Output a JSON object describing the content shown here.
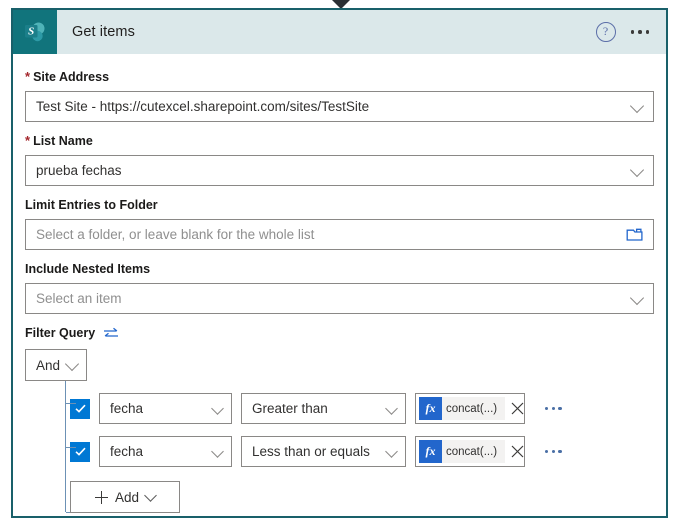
{
  "card": {
    "icon_name": "sharepoint-icon",
    "title": "Get items",
    "header_icons": {
      "help": "help-icon",
      "more": "more-options-icon"
    }
  },
  "fields": [
    {
      "label": "Site Address",
      "required": true,
      "value": "Test Site - https://cutexcel.sharepoint.com/sites/TestSite",
      "is_placeholder": false,
      "trailing_icon": "chevron-down-icon"
    },
    {
      "label": "List Name",
      "required": true,
      "value": "prueba fechas",
      "is_placeholder": false,
      "trailing_icon": "chevron-down-icon"
    },
    {
      "label": "Limit Entries to Folder",
      "required": false,
      "value": "Select a folder, or leave blank for the whole list",
      "is_placeholder": true,
      "trailing_icon": "folder-icon"
    },
    {
      "label": "Include Nested Items",
      "required": false,
      "value": "Select an item",
      "is_placeholder": true,
      "trailing_icon": "chevron-down-icon"
    }
  ],
  "filter_query": {
    "label": "Filter Query",
    "swap_icon": "swap-arrows-icon",
    "group_operator": "And",
    "conditions": [
      {
        "checked": true,
        "field": "fecha",
        "operator": "Greater than",
        "value_token": "concat(...)",
        "value_badge": "fx",
        "remove_icon": "close-icon",
        "row_menu_icon": "more-options-icon"
      },
      {
        "checked": true,
        "field": "fecha",
        "operator": "Less than or equals",
        "value_token": "concat(...)",
        "value_badge": "fx",
        "remove_icon": "close-icon",
        "row_menu_icon": "more-options-icon"
      }
    ],
    "add_button": "Add"
  },
  "colors": {
    "card_border": "#19606a",
    "header_bg": "#dbe8ea",
    "sharepoint_teal": "#11747c",
    "accent_blue": "#0078d4",
    "fx_blue": "#2266cc",
    "required_red": "#a4262c",
    "tree_line": "#6c91b5"
  }
}
